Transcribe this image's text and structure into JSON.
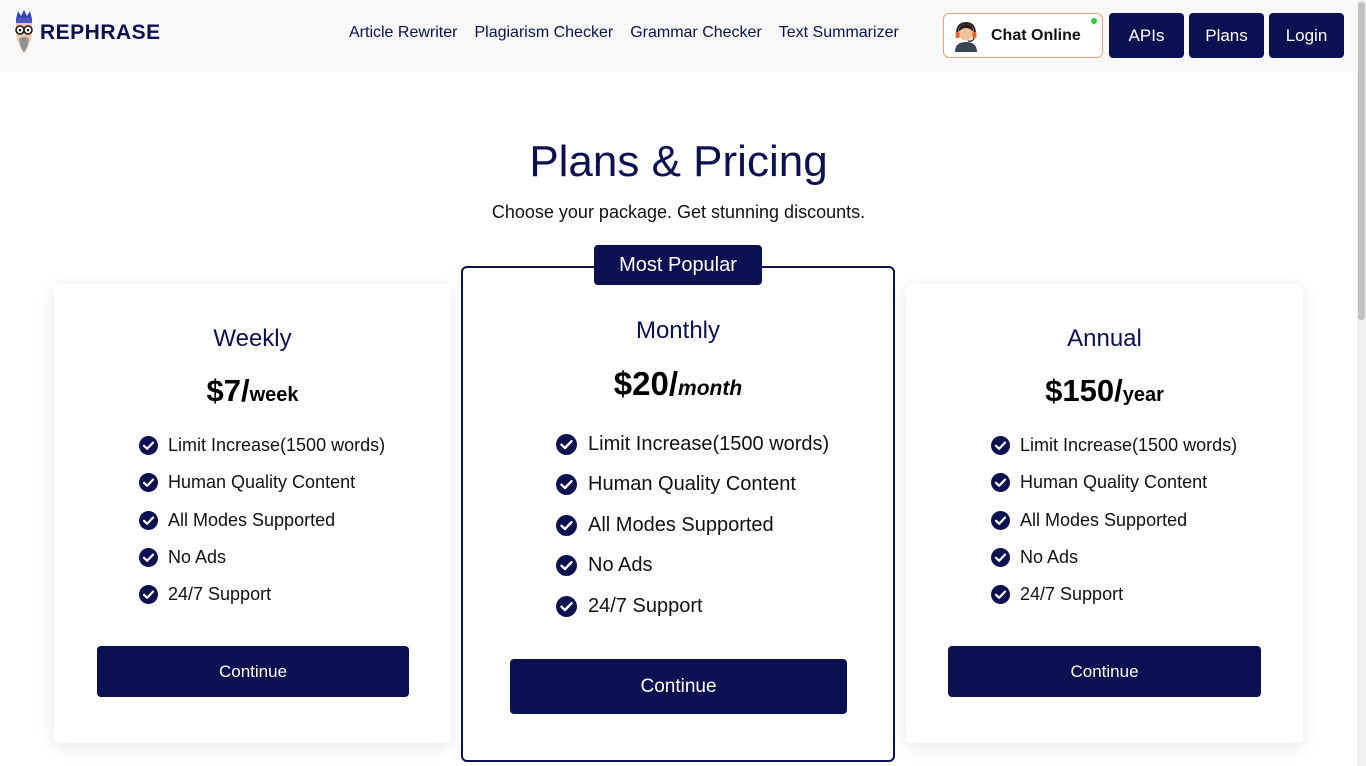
{
  "header": {
    "logo_text": "REPHRASE",
    "nav": [
      "Article Rewriter",
      "Plagiarism Checker",
      "Grammar Checker",
      "Text Summarizer"
    ],
    "chat_label": "Chat Online",
    "buttons": {
      "apis": "APIs",
      "plans": "Plans",
      "login": "Login"
    }
  },
  "hero": {
    "title": "Plans & Pricing",
    "subtitle": "Choose your package. Get stunning discounts."
  },
  "plans": [
    {
      "name": "Weekly",
      "price": "$7/",
      "period": "week",
      "features": [
        "Limit Increase(1500 words)",
        "Human Quality Content",
        "All Modes Supported",
        "No Ads",
        "24/7 Support"
      ],
      "button": "Continue"
    },
    {
      "name": "Monthly",
      "badge": "Most Popular",
      "price": "$20/",
      "period": "month",
      "features": [
        "Limit Increase(1500 words)",
        "Human Quality Content",
        "All Modes Supported",
        "No Ads",
        "24/7 Support"
      ],
      "button": "Continue"
    },
    {
      "name": "Annual",
      "price": "$150/",
      "period": "year",
      "features": [
        "Limit Increase(1500 words)",
        "Human Quality Content",
        "All Modes Supported",
        "No Ads",
        "24/7 Support"
      ],
      "button": "Continue"
    }
  ],
  "colors": {
    "primary": "#0b1150",
    "chat_border": "#e9a37a",
    "online": "#2ecc40"
  },
  "icons": {
    "check": "check-circle-icon",
    "logo": "rephrase-mascot-icon",
    "chat": "support-agent-icon"
  }
}
